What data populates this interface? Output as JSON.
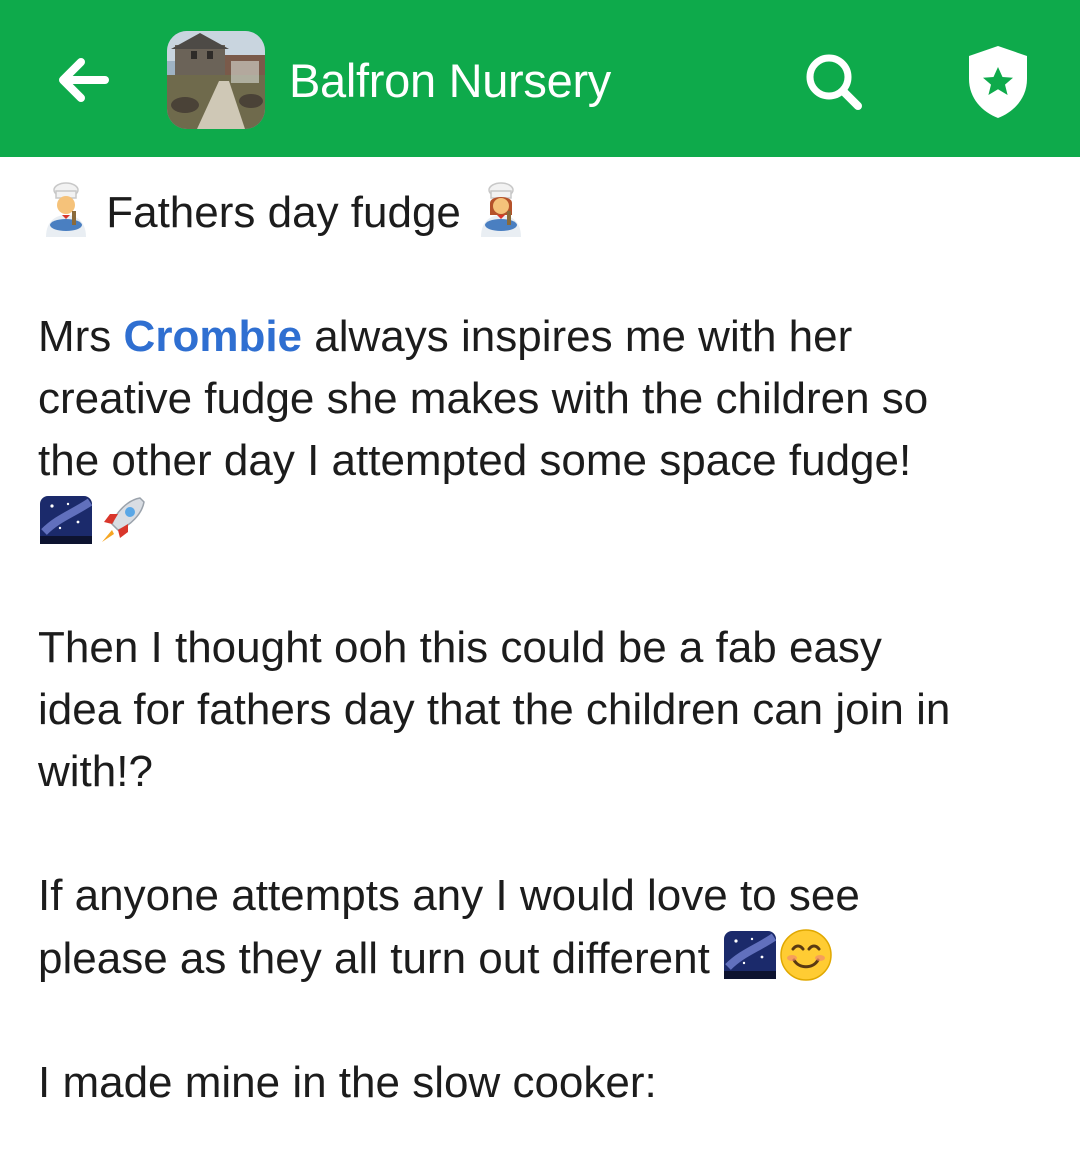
{
  "header": {
    "title": "Balfron Nursery",
    "back_icon": "arrow-left-icon",
    "search_icon": "search-icon",
    "shield_icon": "shield-star-icon",
    "background_color": "#0eaa4b"
  },
  "post": {
    "title_line": "Fathers day fudge",
    "title_emoji_left": "man-cook-emoji",
    "title_emoji_right": "woman-cook-emoji",
    "p1_before": "Mrs",
    "mention": "Crombie",
    "p1_after_line1": "always inspires me with her",
    "p1_line2": "creative fudge she makes with the children so",
    "p1_line3": "the other day I attempted some space fudge!",
    "p1_emojis": [
      "milky-way-emoji",
      "rocket-emoji"
    ],
    "p2_line1": "Then I thought ooh this could be a fab easy",
    "p2_line2": "idea for fathers day that the children can join in",
    "p2_line3": "with!?",
    "p3_line1": "If anyone attempts any I would love to see",
    "p3_line2": "please as they all turn out different",
    "p3_emojis": [
      "milky-way-emoji",
      "smiling-face-emoji"
    ],
    "p4_line1": "I made mine in the slow cooker:",
    "mention_color": "#2f6fd1"
  }
}
